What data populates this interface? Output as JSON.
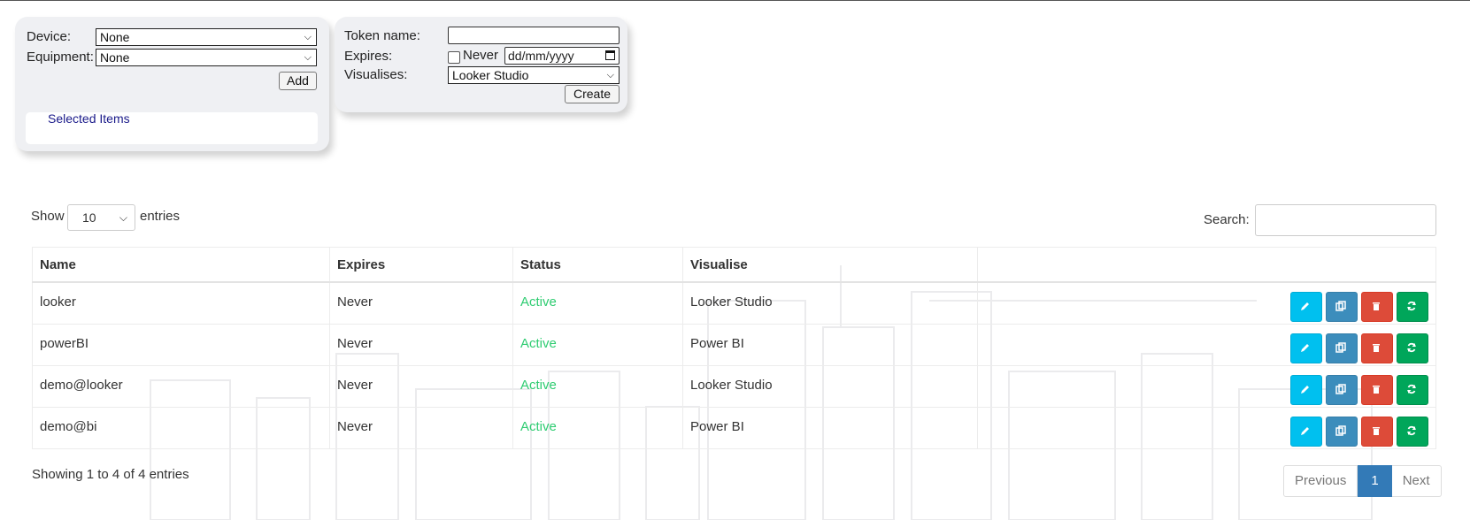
{
  "form_filter": {
    "device_label": "Device:",
    "device_value": "None",
    "equipment_label": "Equipment:",
    "equipment_value": "None",
    "add_label": "Add",
    "selected_items_label": "Selected Items"
  },
  "form_token": {
    "token_name_label": "Token name:",
    "token_name_value": "",
    "expires_label": "Expires:",
    "never_label": "Never",
    "never_checked": false,
    "date_placeholder": "dd/mm/yyyy",
    "visualises_label": "Visualises:",
    "visualises_value": "Looker Studio",
    "create_label": "Create"
  },
  "table_controls": {
    "show_label": "Show",
    "page_length": "10",
    "entries_label": "entries",
    "search_label": "Search:",
    "search_value": ""
  },
  "table": {
    "columns": [
      "Name",
      "Expires",
      "Status",
      "Visualise",
      ""
    ],
    "rows": [
      {
        "name": "looker",
        "expires": "Never",
        "status": "Active",
        "visualise": "Looker Studio"
      },
      {
        "name": "powerBI",
        "expires": "Never",
        "status": "Active",
        "visualise": "Power BI"
      },
      {
        "name": "demo@looker",
        "expires": "Never",
        "status": "Active",
        "visualise": "Looker Studio"
      },
      {
        "name": "demo@bi",
        "expires": "Never",
        "status": "Active",
        "visualise": "Power BI"
      }
    ],
    "row_action_icons": [
      "pencil-icon",
      "copy-icon",
      "trash-icon",
      "refresh-icon"
    ]
  },
  "footer": {
    "info": "Showing 1 to 4 of 4 entries",
    "previous_label": "Previous",
    "current_page": "1",
    "next_label": "Next"
  },
  "colors": {
    "status_active": "#2ecc71",
    "edit": "#00c0ef",
    "copy": "#3c8dbc",
    "delete": "#dd4b39",
    "refresh": "#00a65a",
    "page_active": "#337ab7"
  }
}
